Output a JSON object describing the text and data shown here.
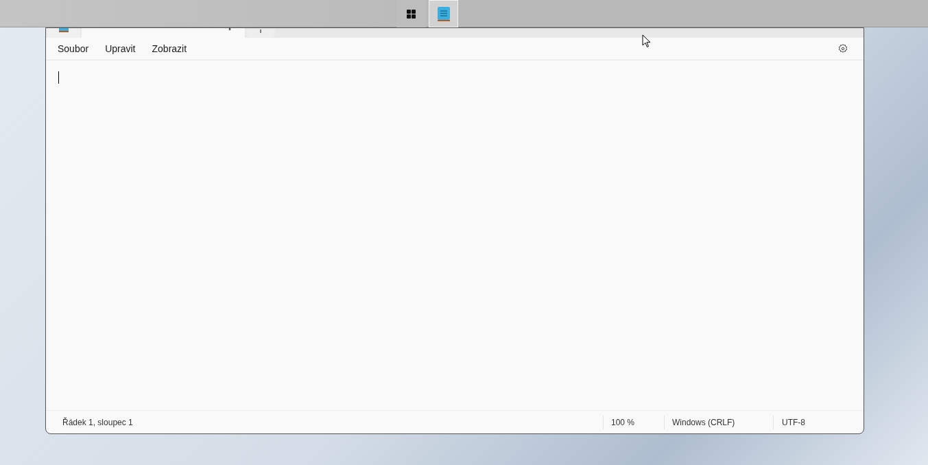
{
  "taskbar": {
    "buttons": [
      {
        "kind": "start",
        "selected": false
      },
      {
        "kind": "notepad",
        "selected": true
      }
    ]
  },
  "tabs": [
    {
      "selected": true
    }
  ],
  "menu": [
    "Soubor",
    "Upravit",
    "Zobrazit"
  ],
  "status_bar": {
    "position": "Řádek 1, sloupec 1",
    "zoom": "100 %",
    "line_ending": "Windows (CRLF)",
    "encoding": "UTF-8"
  }
}
